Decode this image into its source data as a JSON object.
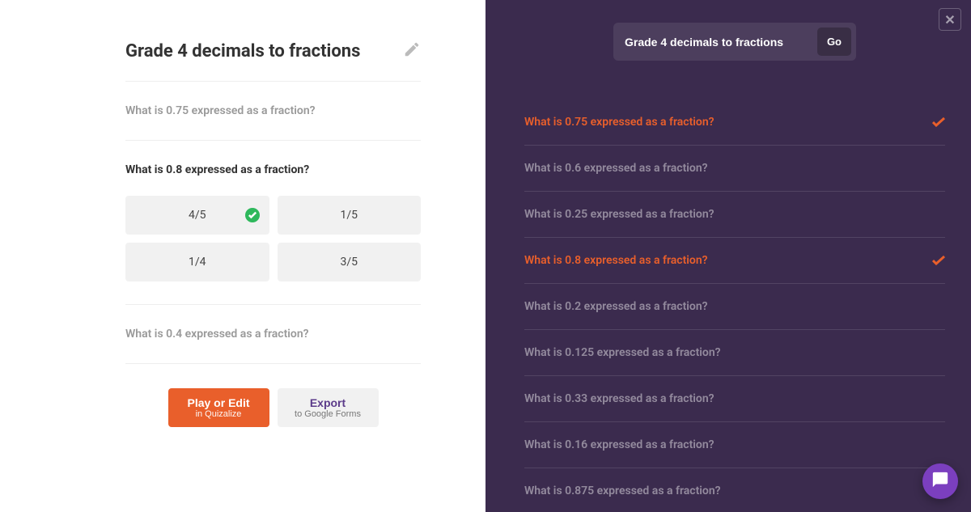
{
  "left": {
    "title": "Grade 4 decimals to fractions",
    "questions": [
      {
        "text": "What is 0.75 expressed as a fraction?",
        "expanded": false
      },
      {
        "text": "What is 0.8 expressed as a fraction?",
        "expanded": true,
        "answers": [
          {
            "label": "4/5",
            "correct": true
          },
          {
            "label": "1/5",
            "correct": false
          },
          {
            "label": "1/4",
            "correct": false
          },
          {
            "label": "3/5",
            "correct": false
          }
        ]
      },
      {
        "text": "What is 0.4 expressed as a fraction?",
        "expanded": false
      }
    ],
    "play_btn": {
      "main": "Play or Edit",
      "sub": "in Quizalize"
    },
    "export_btn": {
      "main": "Export",
      "sub": "to Google Forms"
    }
  },
  "right": {
    "search_value": "Grade 4 decimals to fractions",
    "go_label": "Go",
    "results": [
      {
        "label": "What is 0.75 expressed as a fraction?",
        "selected": true
      },
      {
        "label": "What is 0.6 expressed as a fraction?",
        "selected": false
      },
      {
        "label": "What is 0.25 expressed as a fraction?",
        "selected": false
      },
      {
        "label": "What is 0.8 expressed as a fraction?",
        "selected": true
      },
      {
        "label": "What is 0.2 expressed as a fraction?",
        "selected": false
      },
      {
        "label": "What is 0.125 expressed as a fraction?",
        "selected": false
      },
      {
        "label": "What is 0.33 expressed as a fraction?",
        "selected": false
      },
      {
        "label": "What is 0.16 expressed as a fraction?",
        "selected": false
      },
      {
        "label": "What is 0.875 expressed as a fraction?",
        "selected": false
      }
    ]
  }
}
